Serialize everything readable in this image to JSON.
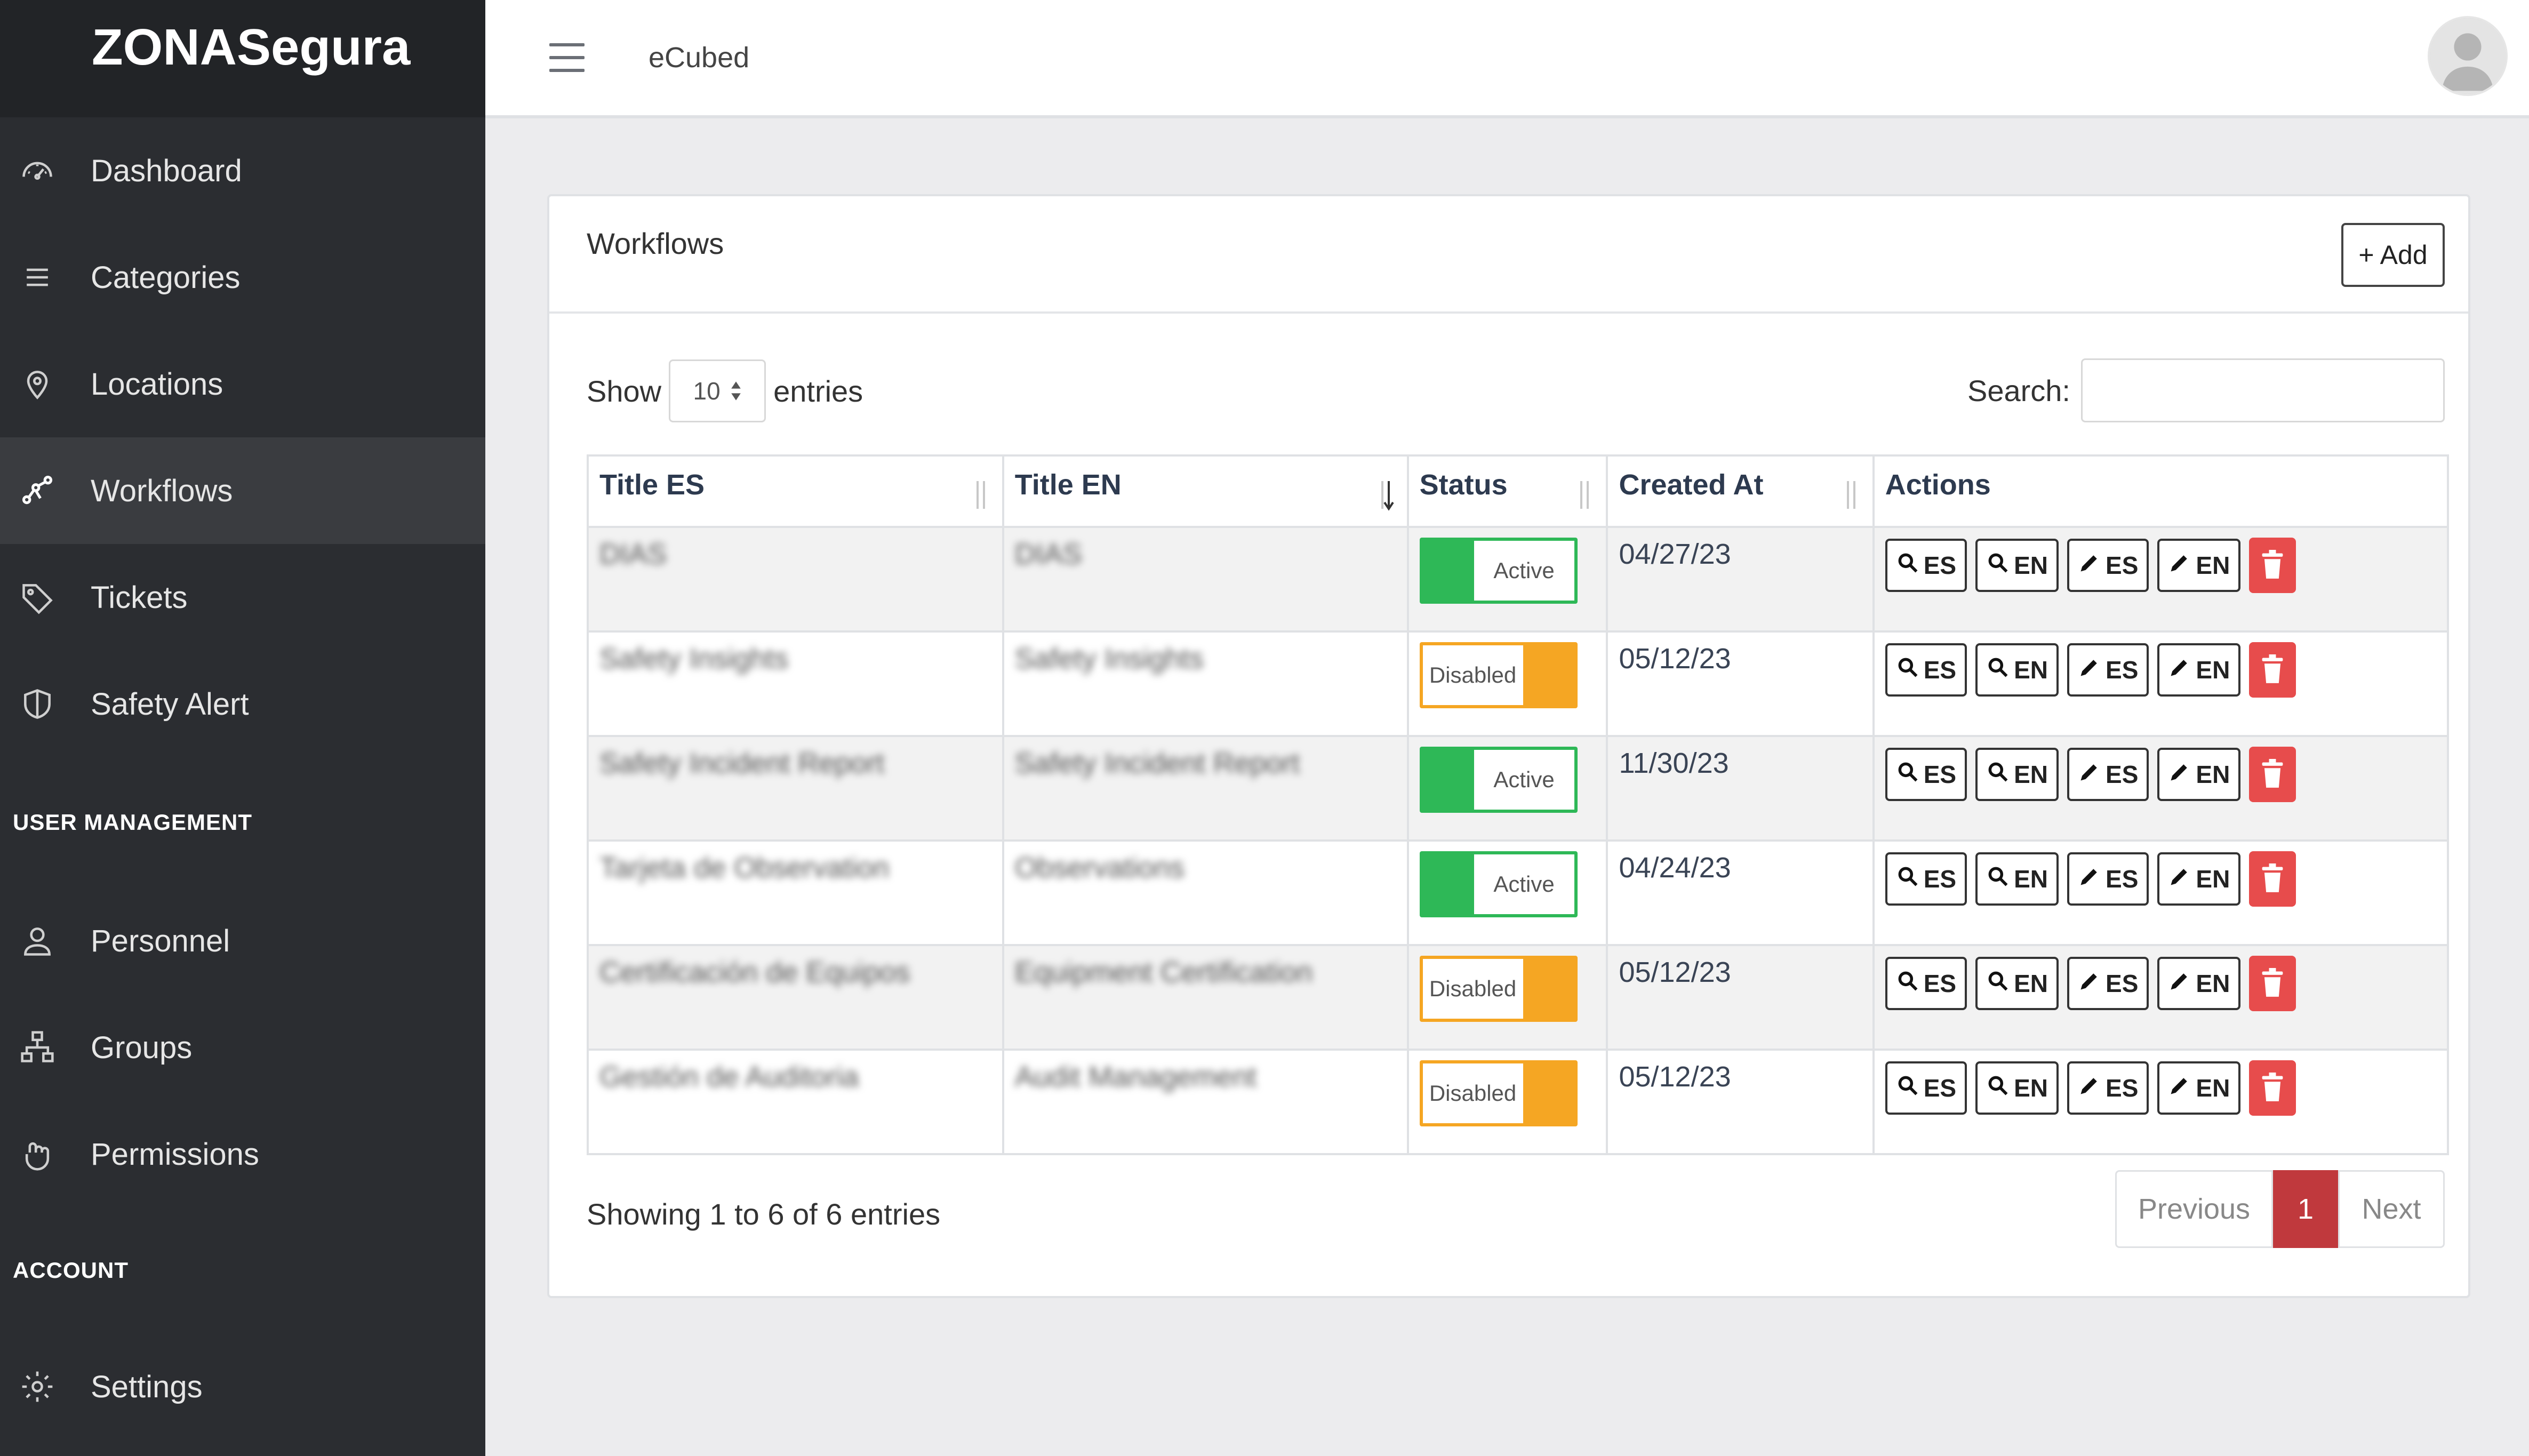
{
  "app": {
    "brand": "ZONASegura"
  },
  "sidebar": {
    "items": [
      {
        "label": "Dashboard",
        "icon": "dashboard-icon",
        "active": false
      },
      {
        "label": "Categories",
        "icon": "menu-icon",
        "active": false
      },
      {
        "label": "Locations",
        "icon": "location-pin-icon",
        "active": false
      },
      {
        "label": "Workflows",
        "icon": "workflow-icon",
        "active": true
      },
      {
        "label": "Tickets",
        "icon": "tag-icon",
        "active": false
      },
      {
        "label": "Safety Alert",
        "icon": "shield-icon",
        "active": false
      }
    ],
    "user_section": "USER MANAGEMENT",
    "user_items": [
      {
        "label": "Personnel",
        "icon": "person-icon"
      },
      {
        "label": "Groups",
        "icon": "groups-icon"
      },
      {
        "label": "Permissions",
        "icon": "hand-icon"
      }
    ],
    "account_section": "ACCOUNT",
    "account_items": [
      {
        "label": "Settings",
        "icon": "gear-icon"
      }
    ]
  },
  "topbar": {
    "breadcrumb": "eCubed"
  },
  "card": {
    "title": "Workflows",
    "add_label": "+ Add",
    "show_label": "Show",
    "entries_value": "10",
    "entries_label": "entries",
    "search_label": "Search:",
    "search_value": ""
  },
  "table": {
    "columns": [
      "Title ES",
      "Title EN",
      "Status",
      "Created At",
      "Actions"
    ],
    "rows": [
      {
        "title_es": "DIAS",
        "title_en": "DIAS",
        "status": "Active",
        "created": "04/27/23"
      },
      {
        "title_es": "Safety Insights",
        "title_en": "Safety Insights",
        "status": "Disabled",
        "created": "05/12/23"
      },
      {
        "title_es": "Safety Incident Report",
        "title_en": "Safety Incident Report",
        "status": "Active",
        "created": "11/30/23"
      },
      {
        "title_es": "Tarjeta de Observation",
        "title_en": "Observations",
        "status": "Active",
        "created": "04/24/23"
      },
      {
        "title_es": "Certificación de Equipos",
        "title_en": "Equipment Certification",
        "status": "Disabled",
        "created": "05/12/23"
      },
      {
        "title_es": "Gestión de Auditoria",
        "title_en": "Audit Management",
        "status": "Disabled",
        "created": "05/12/23"
      }
    ],
    "action_labels": {
      "view_es": "ES",
      "view_en": "EN",
      "edit_es": "ES",
      "edit_en": "EN"
    }
  },
  "footer": {
    "info": "Showing 1 to 6 of 6 entries",
    "prev": "Previous",
    "page": "1",
    "next": "Next"
  },
  "colors": {
    "sidebar_bg": "#2b2d31",
    "active_green": "#2eb857",
    "disabled_orange": "#f5a623",
    "delete_red": "#e74c4c",
    "pagination_active": "#c0393d"
  }
}
